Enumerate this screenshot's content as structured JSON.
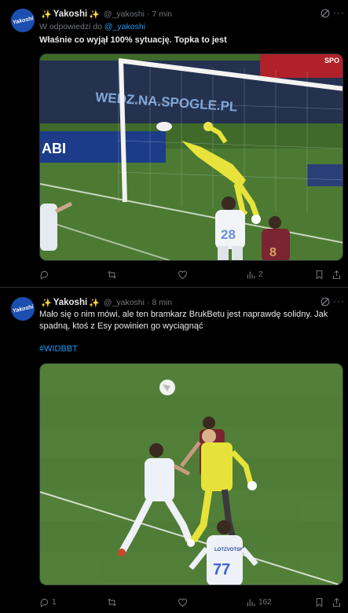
{
  "tweets": [
    {
      "display_name": "Yakoshi",
      "handle": "@_yakoshi",
      "time": "7 min",
      "reply_prefix": "W odpowiedzi do",
      "reply_handle": "@_yakoshi",
      "text": "Właśnie co wyjął 100% sytuację. Topka to jest",
      "hashtag": "",
      "media": {
        "banner_text": "WEDZ.NA.SPOGLE.PL",
        "sponsor_text": "ABI",
        "scoreboard_text": "SPO",
        "player_numbers": [
          "28",
          "8"
        ]
      },
      "metrics": {
        "replies": "",
        "reposts": "",
        "likes": "",
        "views": "2"
      }
    },
    {
      "display_name": "Yakoshi",
      "handle": "@_yakoshi",
      "time": "8 min",
      "reply_prefix": "",
      "reply_handle": "",
      "text": "Mało się o nim mówi, ale ten bramkarz BrukBetu jest naprawdę solidny. Jak spadną, ktoś z Esy powinien go wyciągnąć",
      "hashtag": "#WIDBBT",
      "media": {
        "player_numbers": [
          "77"
        ],
        "shirt_name": "LOTZVOTSKIY"
      },
      "metrics": {
        "replies": "1",
        "reposts": "",
        "likes": "",
        "views": "162"
      }
    }
  ],
  "avatar_text": "Yakoshi",
  "colors": {
    "background": "#000000",
    "text": "#e7e9ea",
    "muted": "#71767b",
    "link": "#1d9bf0",
    "divider": "#2f3336",
    "star": "#f5c518"
  }
}
